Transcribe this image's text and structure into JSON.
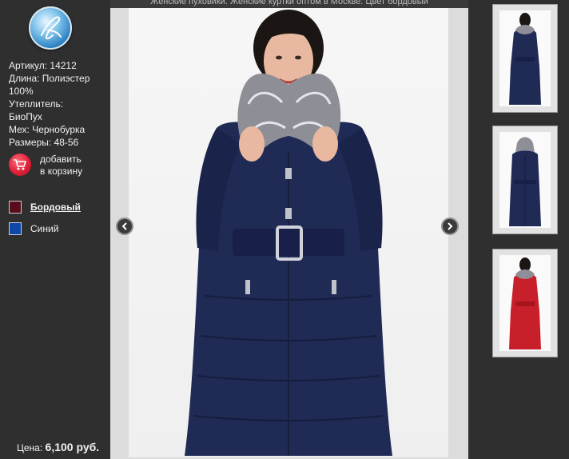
{
  "caption": "Женские пуховики. Женские куртки оптом в Москве. Цвет бордовый",
  "specs": {
    "article": "Артикул: 14212",
    "length_1": "Длина: Полиэстер",
    "length_2": "100%",
    "filler_1": "Утеплитель:",
    "filler_2": "БиоПух",
    "fur": "Мех: Чернобурка",
    "sizes": "Размеры: 48-56"
  },
  "cart": {
    "line1": "добавить",
    "line2": "в корзину",
    "icon": "shopping-cart-icon"
  },
  "colors": [
    {
      "label": "Бордовый",
      "color": "#5a0b1c",
      "selected": true
    },
    {
      "label": "Синий",
      "color": "#0d47a8",
      "selected": false
    }
  ],
  "price": {
    "label": "Цена:",
    "value": "6,100 руб."
  },
  "navigation": {
    "prev_icon": "chevron-left-icon",
    "next_icon": "chevron-right-icon"
  },
  "product_colors": {
    "navy": "#1f2a55",
    "red": "#c8202a",
    "fur": "#9a9aa2"
  },
  "thumbnails": [
    {
      "icon": "product-thumbnail-front-navy",
      "coat_color": "#1f2a55"
    },
    {
      "icon": "product-thumbnail-back-navy",
      "coat_color": "#1f2a55"
    },
    {
      "icon": "product-thumbnail-front-red",
      "coat_color": "#c8202a"
    }
  ]
}
